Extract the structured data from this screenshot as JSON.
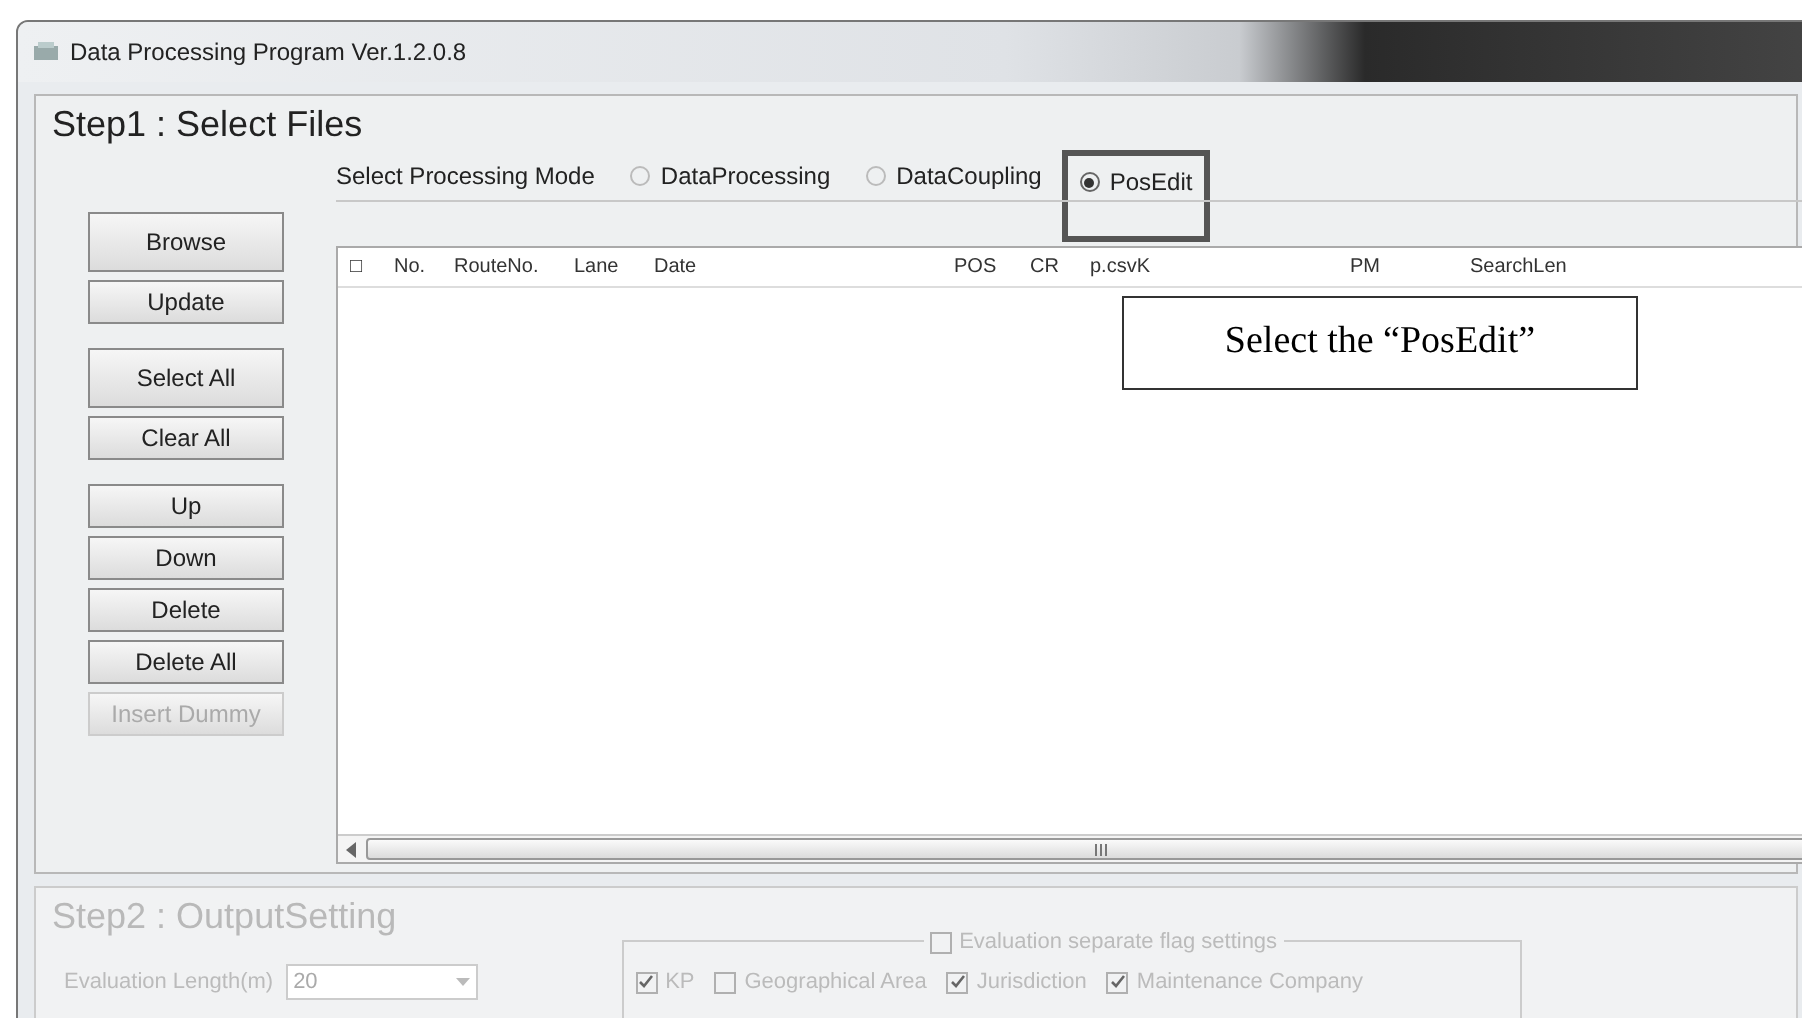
{
  "window": {
    "title": "Data Processing Program Ver.1.2.0.8"
  },
  "step1": {
    "title": "Step1 : Select Files",
    "mode_label": "Select Processing Mode",
    "modes": [
      {
        "label": "DataProcessing",
        "selected": false
      },
      {
        "label": "DataCoupling",
        "selected": false
      },
      {
        "label": "PosEdit",
        "selected": true,
        "highlighted": true
      }
    ],
    "buttons": [
      {
        "label": "Browse",
        "disabled": false
      },
      {
        "label": "Update",
        "disabled": false
      },
      {
        "label": "Select All",
        "disabled": false
      },
      {
        "label": "Clear All",
        "disabled": false
      },
      {
        "label": "Up",
        "disabled": false
      },
      {
        "label": "Down",
        "disabled": false
      },
      {
        "label": "Delete",
        "disabled": false
      },
      {
        "label": "Delete All",
        "disabled": false
      },
      {
        "label": "Insert Dummy",
        "disabled": true
      }
    ],
    "table": {
      "columns": [
        "□",
        "No.",
        "RouteNo.",
        "Lane",
        "Date",
        "POS",
        "CR",
        "p.csvK",
        "PM",
        "SearchLen"
      ]
    }
  },
  "callout": {
    "text": "Select the “PosEdit”"
  },
  "step2": {
    "title": "Step2 : OutputSetting",
    "length_label": "Evaluation Length(m)",
    "length_value": "20",
    "flag_group": {
      "label": "Evaluation separate flag settings",
      "checked": false,
      "options": [
        {
          "label": "KP",
          "checked": true
        },
        {
          "label": "Geographical Area",
          "checked": false
        },
        {
          "label": "Jurisdiction",
          "checked": true
        },
        {
          "label": "Maintenance Company",
          "checked": true
        }
      ]
    }
  }
}
